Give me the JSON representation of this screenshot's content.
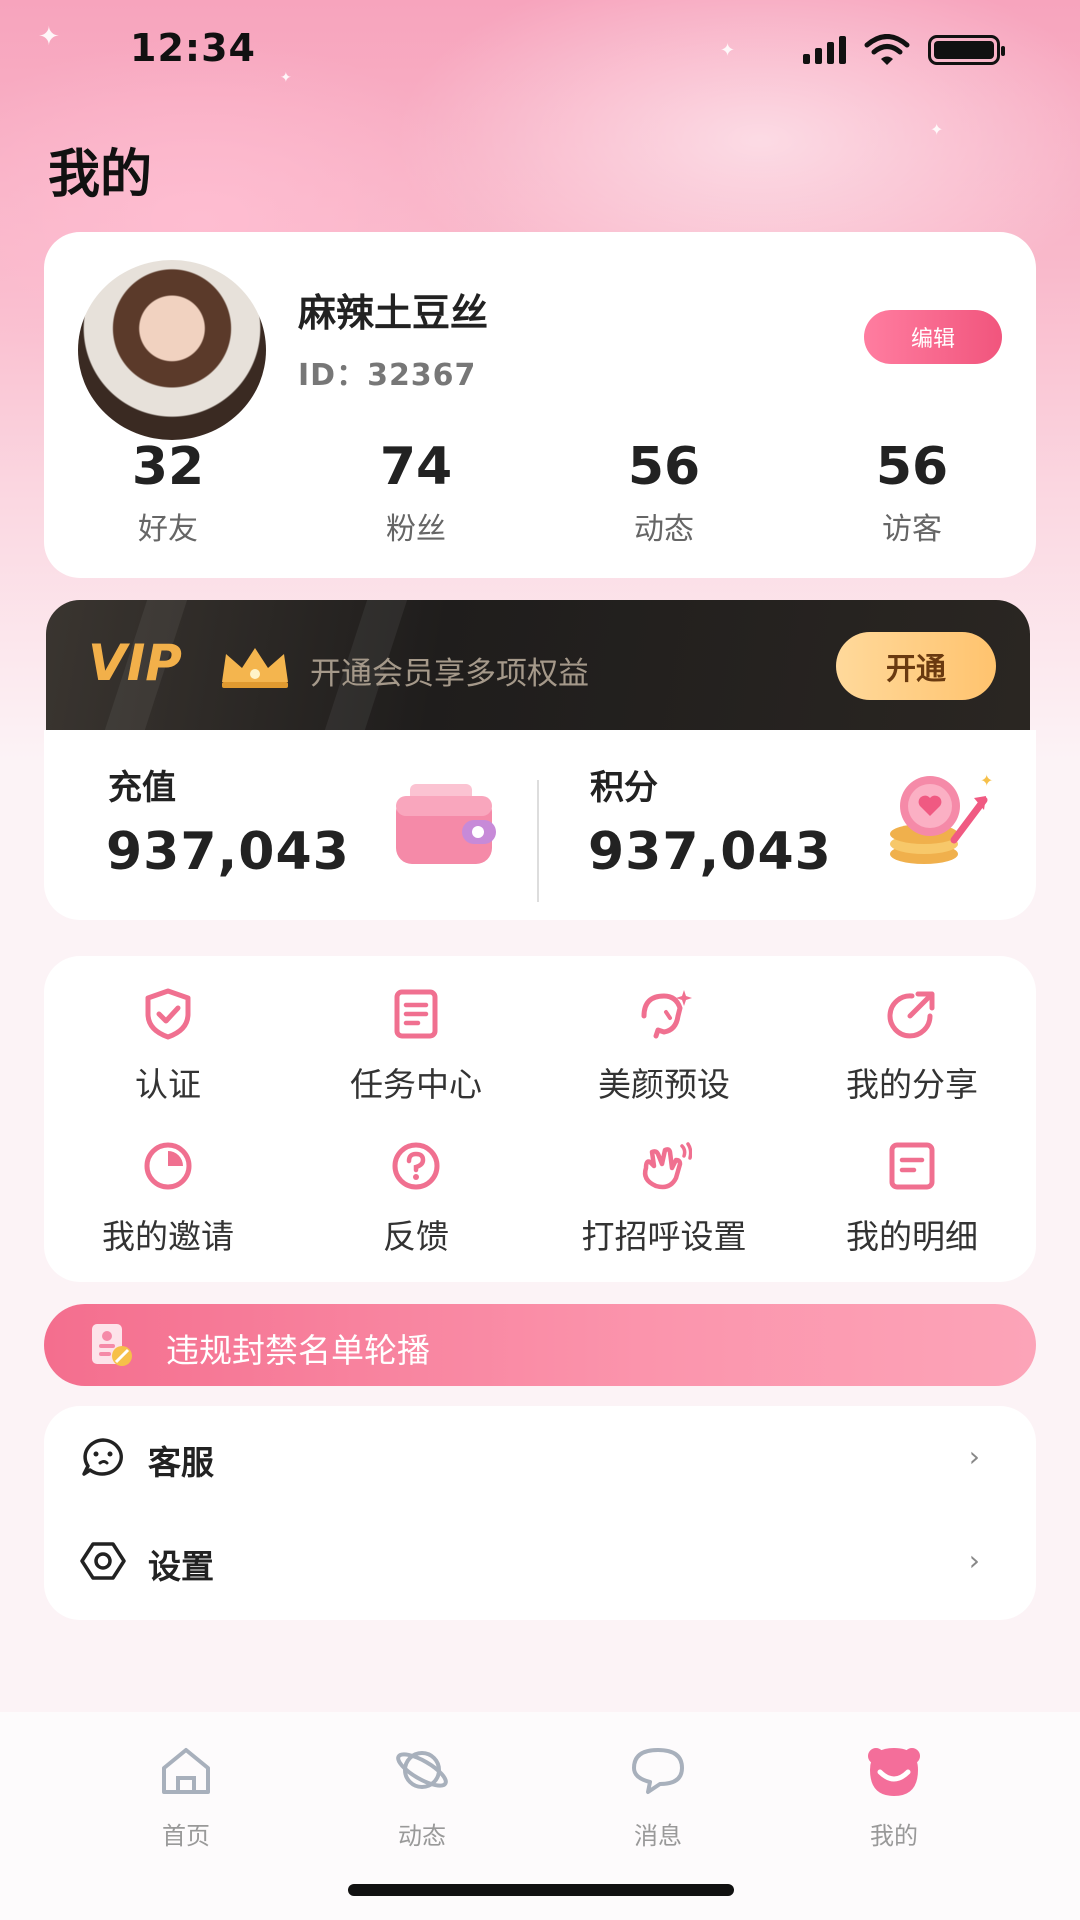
{
  "status_bar": {
    "time": "12:34"
  },
  "page_title": "我的",
  "profile": {
    "nickname": "麻辣土豆丝",
    "id_text": "ID：32367",
    "edit_label": "编辑",
    "stats": [
      {
        "value": "32",
        "label": "好友"
      },
      {
        "value": "74",
        "label": "粉丝"
      },
      {
        "value": "56",
        "label": "动态"
      },
      {
        "value": "56",
        "label": "访客"
      }
    ]
  },
  "vip": {
    "logo": "VIP",
    "tagline": "开通会员享多项权益",
    "button_label": "开通"
  },
  "wallet": {
    "recharge_label": "充值",
    "recharge_value": "937,043",
    "points_label": "积分",
    "points_value": "937,043"
  },
  "features": [
    {
      "label": "认证",
      "icon": "shield-check-icon"
    },
    {
      "label": "任务中心",
      "icon": "task-list-icon"
    },
    {
      "label": "美颜预设",
      "icon": "beauty-face-icon"
    },
    {
      "label": "我的分享",
      "icon": "share-icon"
    },
    {
      "label": "我的邀请",
      "icon": "invite-pie-icon"
    },
    {
      "label": "反馈",
      "icon": "question-icon"
    },
    {
      "label": "打招呼设置",
      "icon": "wave-hand-icon"
    },
    {
      "label": "我的明细",
      "icon": "detail-doc-icon"
    }
  ],
  "banner": {
    "text": "违规封禁名单轮播"
  },
  "menu": {
    "customer_service": "客服",
    "settings": "设置"
  },
  "tabbar": [
    {
      "label": "首页",
      "icon": "home-icon"
    },
    {
      "label": "动态",
      "icon": "planet-icon"
    },
    {
      "label": "消息",
      "icon": "chat-bubble-icon"
    },
    {
      "label": "我的",
      "icon": "profile-mascot-icon",
      "active": true
    }
  ],
  "colors": {
    "accent": "#f1557d",
    "vip_gold": "#f2b04a",
    "icon_pink": "#f07090"
  }
}
